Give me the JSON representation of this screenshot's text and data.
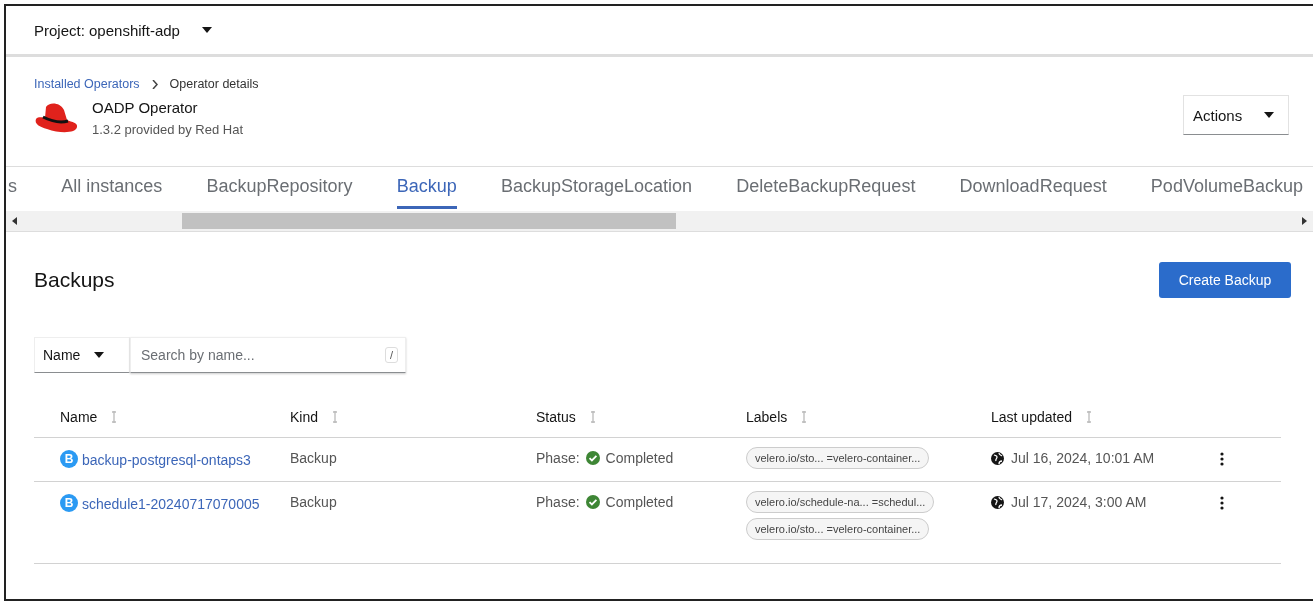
{
  "project": {
    "label": "Project: openshift-adp"
  },
  "breadcrumb": [
    {
      "label": "Installed Operators",
      "link": true
    },
    {
      "label": "Operator details",
      "link": false
    }
  ],
  "operator": {
    "name": "OADP Operator",
    "subtitle": "1.3.2 provided by Red Hat"
  },
  "actions_button": "Actions",
  "tabs": [
    {
      "label": "s",
      "selected": false
    },
    {
      "label": "All instances",
      "selected": false
    },
    {
      "label": "BackupRepository",
      "selected": false
    },
    {
      "label": "Backup",
      "selected": true
    },
    {
      "label": "BackupStorageLocation",
      "selected": false
    },
    {
      "label": "DeleteBackupRequest",
      "selected": false
    },
    {
      "label": "DownloadRequest",
      "selected": false
    },
    {
      "label": "PodVolumeBackup",
      "selected": false
    }
  ],
  "heading": "Backups",
  "create_button": "Create Backup",
  "filter": {
    "dropdown": "Name",
    "placeholder": "Search by name...",
    "shortcut": "/"
  },
  "table": {
    "columns": [
      "Name",
      "Kind",
      "Status",
      "Labels",
      "Last updated"
    ],
    "rows": [
      {
        "badge": "B",
        "name": "backup-postgresql-ontaps3",
        "kind": "Backup",
        "phase": "Phase:",
        "status": "Completed",
        "labels": [
          "velero.io/sto... =velero-container..."
        ],
        "updated": "Jul 16, 2024, 10:01 AM"
      },
      {
        "badge": "B",
        "name": "schedule1-20240717070005",
        "kind": "Backup",
        "phase": "Phase:",
        "status": "Completed",
        "labels": [
          "velero.io/schedule-na... =schedul...",
          "velero.io/sto... =velero-container..."
        ],
        "updated": "Jul 17, 2024, 3:00 AM"
      }
    ]
  }
}
